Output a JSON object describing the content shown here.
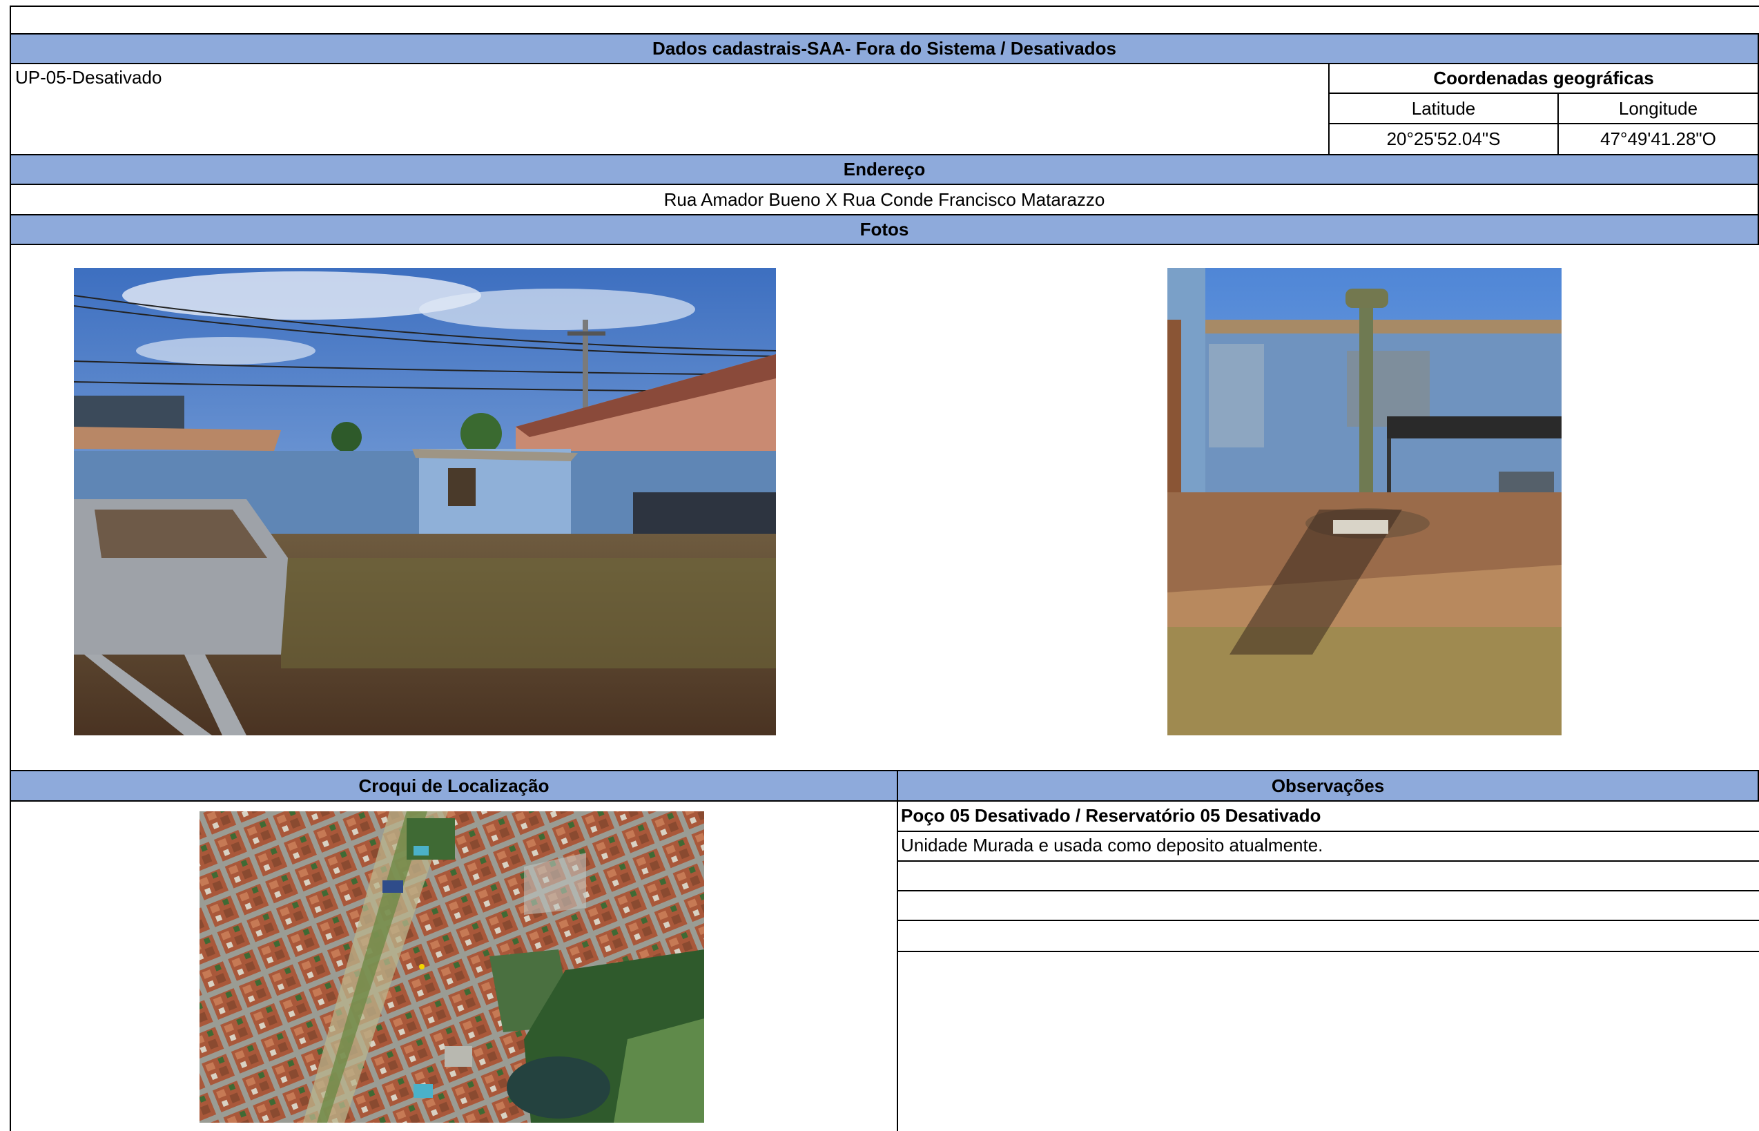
{
  "header": {
    "title": "Dados cadastrais-SAA- Fora do Sistema / Desativados"
  },
  "unit": {
    "name": "UP-05-Desativado"
  },
  "coordinates": {
    "label": "Coordenadas geográficas",
    "latitude_label": "Latitude",
    "longitude_label": "Longitude",
    "latitude": "20°25'52.04\"S",
    "longitude": "47°49'41.28\"O"
  },
  "address": {
    "label": "Endereço",
    "value": "Rua Amador Bueno X Rua Conde Francisco Matarazzo"
  },
  "photos": {
    "label": "Fotos"
  },
  "location_sketch": {
    "label": "Croqui de Localização"
  },
  "observations": {
    "label": "Observações",
    "lines": [
      "Poço 05 Desativado / Reservatório 05 Desativado",
      "Unidade Murada e usada como deposito atualmente.",
      "",
      "",
      ""
    ]
  }
}
